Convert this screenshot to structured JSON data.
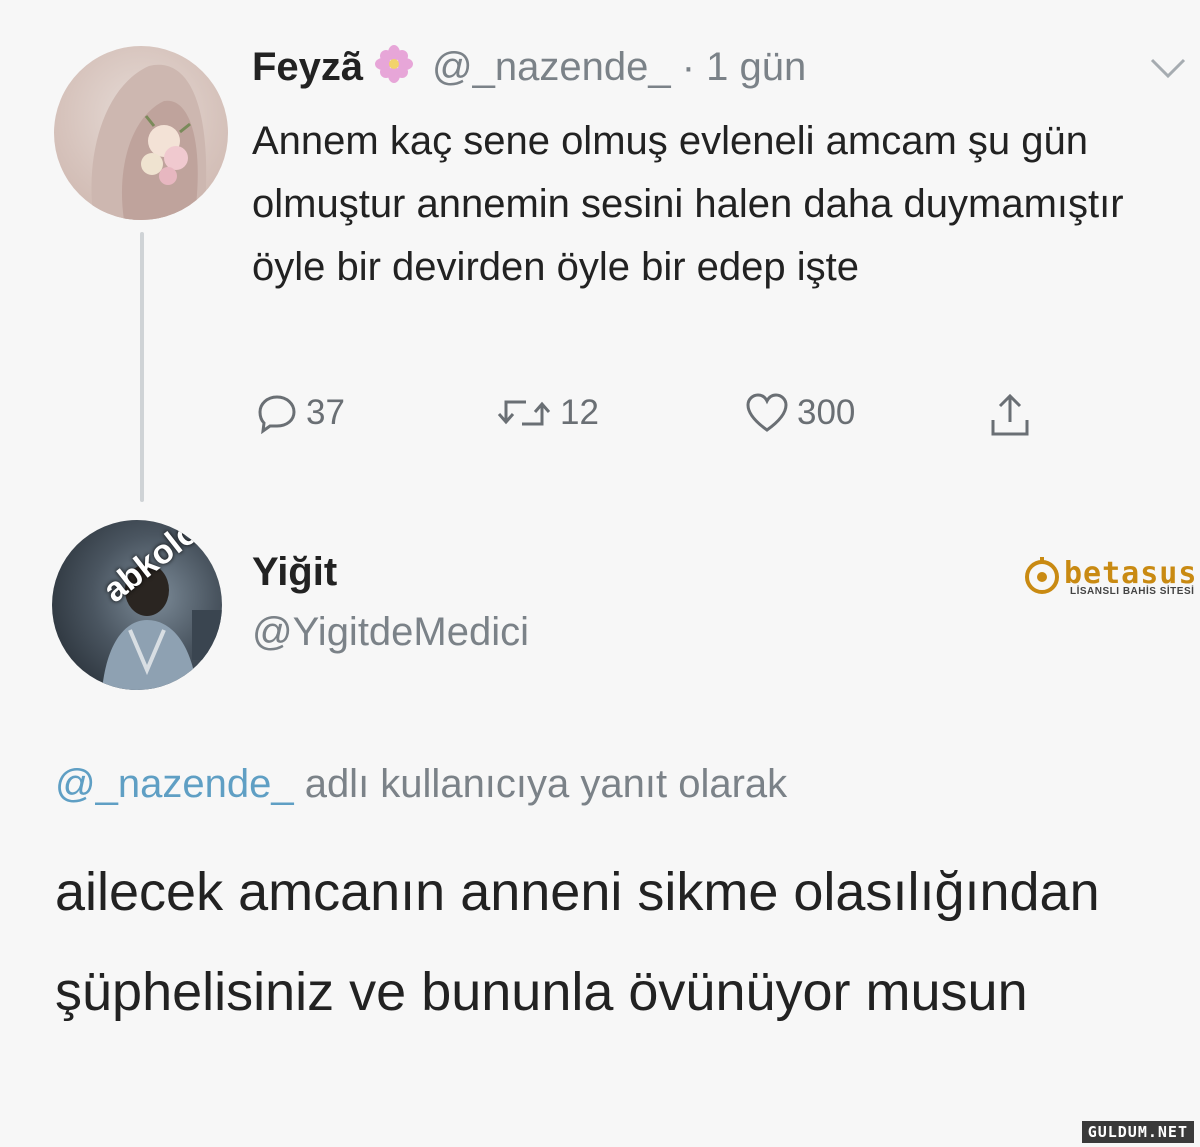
{
  "tweet": {
    "author_name": "Feyzã",
    "author_emoji": "flower-icon",
    "handle_time": "@_nazende_ · 1 gün",
    "text": "Annem kaç sene olmuş evleneli amcam şu gün olmuştur annemin sesini halen daha duymamıştır öyle bir devirden öyle bir edep işte",
    "stats": {
      "replies": "37",
      "retweets": "12",
      "likes": "300"
    }
  },
  "reply": {
    "author_name": "Yiğit",
    "handle": "@YigitdeMedici",
    "avatar_label": "abkoloji",
    "replying_mention": "@_nazende_",
    "replying_suffix": " adlı kullanıcıya yanıt olarak",
    "text": "ailecek amcanın anneni sikme olasılığından şüphelisiniz ve bununla övünüyor musun"
  },
  "brand_logo": {
    "word": "betasus",
    "tagline": "LİSANSLI BAHİS SİTESİ"
  },
  "watermark": "GULDUM.NET",
  "colors": {
    "text": "#222222",
    "muted": "#7b8288",
    "mention": "#5f9fc4",
    "logo": "#c98a12"
  }
}
